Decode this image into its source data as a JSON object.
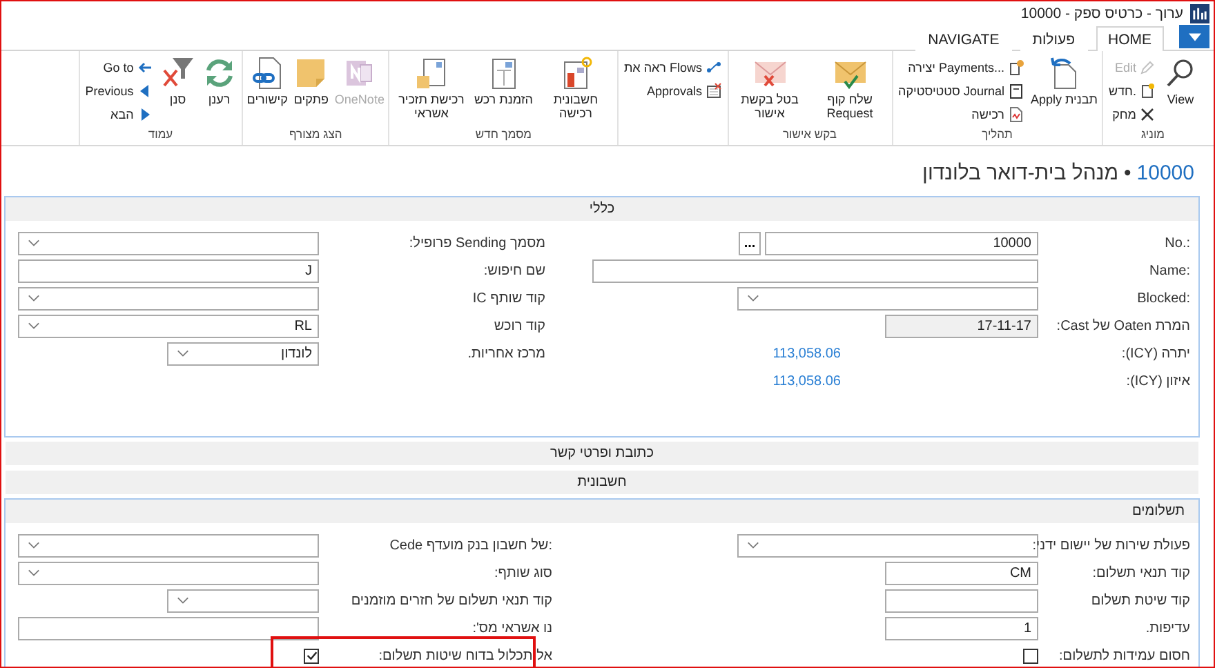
{
  "window": {
    "title": "ערוך - כרטיס ספק - 10000"
  },
  "tabs": [
    {
      "label": "HOME",
      "selected": true
    },
    {
      "label": "פעולות",
      "selected": false
    },
    {
      "label": "NAVIGATE",
      "selected": false
    }
  ],
  "ribbon": {
    "groups": [
      {
        "label": "מוניג",
        "items": [
          {
            "label": "View",
            "kind": "large",
            "disabled": false
          },
          {
            "label": "Edit",
            "kind": "small",
            "disabled": true
          },
          {
            "label": "חדש.",
            "kind": "small",
            "disabled": false
          },
          {
            "label": "מחק",
            "kind": "small",
            "disabled": false
          }
        ]
      },
      {
        "label": "תהליך",
        "items": [
          {
            "label": "Apply תבנית",
            "kind": "large",
            "disabled": false
          },
          {
            "label": "יצירה Payments...",
            "kind": "small",
            "disabled": false
          },
          {
            "label": "סטטיסטיקה Journal",
            "kind": "small",
            "disabled": false
          },
          {
            "label": "רכישה",
            "kind": "small",
            "disabled": false
          }
        ]
      },
      {
        "label": "בקש אישור",
        "items": [
          {
            "label": "שלח קוף Request",
            "kind": "large",
            "disabled": false
          },
          {
            "label": "בטל בקשת אישור",
            "kind": "large",
            "disabled": false
          }
        ]
      },
      {
        "items": [
          {
            "label": "ראה את Flows",
            "kind": "small",
            "disabled": false
          },
          {
            "label": "Approvals",
            "kind": "small",
            "disabled": false
          }
        ]
      },
      {
        "label": "מסמך חדש",
        "items": [
          {
            "label": "חשבונית רכישה",
            "kind": "large",
            "disabled": false
          },
          {
            "label": "הזמנת רכש",
            "kind": "large",
            "disabled": false
          },
          {
            "label": "רכישת תזכיר אשראי",
            "kind": "large",
            "disabled": false
          }
        ]
      },
      {
        "label": "הצג מצורף",
        "items": [
          {
            "label": "OneNote",
            "kind": "large",
            "disabled": true
          },
          {
            "label": "פתקים",
            "kind": "large",
            "disabled": false
          },
          {
            "label": "קישורים",
            "kind": "large",
            "disabled": false
          }
        ]
      },
      {
        "label": "עמוד",
        "items": [
          {
            "label": "רענן",
            "kind": "large",
            "disabled": false
          },
          {
            "label": "סנן",
            "kind": "large",
            "disabled": false
          },
          {
            "label": "Go to",
            "kind": "small",
            "disabled": false
          },
          {
            "label": "Previous",
            "kind": "small",
            "disabled": false
          },
          {
            "label": "הבא",
            "kind": "small",
            "disabled": false
          }
        ]
      }
    ]
  },
  "page_title": {
    "number": "10000",
    "separator": "•",
    "name": "מנהל בית-דואר בלונדון"
  },
  "sections": [
    {
      "title": "כללי",
      "expanded": true,
      "left": [
        {
          "label": "מסמך Sending פרופיל:",
          "kind": "dropdown"
        },
        {
          "label": "שם חיפוש:",
          "kind": "text",
          "value": "J"
        },
        {
          "label": "קוד שותף IC",
          "kind": "dropdown"
        },
        {
          "label": "קוד רוכש",
          "kind": "dropdown",
          "value": "RL"
        },
        {
          "label": "מרכז אחריות.",
          "kind": "small-dropdown",
          "value": "לונדון"
        }
      ],
      "right": [
        {
          "label": "No.:",
          "kind": "lookup",
          "value": "10000",
          "button": "..."
        },
        {
          "label": "Name:",
          "kind": "wide-text"
        },
        {
          "label": "Blocked:",
          "kind": "dropdown"
        },
        {
          "label": "המרת Oaten של Cast:",
          "kind": "readonly",
          "value": "17-11-17"
        },
        {
          "label": "יתרה (ICY):",
          "kind": "amount",
          "value": "113,058.06"
        },
        {
          "label": "איזון (ICY):",
          "kind": "amount",
          "value": "113,058.06"
        }
      ]
    },
    {
      "title": "כתובת ופרטי קשר",
      "expanded": false
    },
    {
      "title": "חשבונית",
      "expanded": false
    },
    {
      "title": "תשלומים",
      "expanded": true,
      "left": [
        {
          "label": "Cede של חשבון בנק מועדף:",
          "kind": "dropdown"
        },
        {
          "label": "סוג שותף:",
          "kind": "dropdown"
        },
        {
          "label": "קוד תנאי תשלום של חזרים מוזמנים",
          "kind": "small-dropdown"
        },
        {
          "label": "נו אשראי מס':",
          "kind": "text"
        },
        {
          "label": "אל תכלול בדוח שיטות תשלום:",
          "kind": "checkbox",
          "checked": true,
          "highlighted": true
        }
      ],
      "right": [
        {
          "label": "פעולת שירות של יישום ידני:",
          "kind": "dropdown"
        },
        {
          "label": "קוד תנאי תשלום:",
          "kind": "small-text",
          "value": "CM"
        },
        {
          "label": "קוד שיטת תשלום",
          "kind": "small-text"
        },
        {
          "label": "עדיפות.",
          "kind": "small-text",
          "value": "1"
        },
        {
          "label": "חסום עמידות לתשלום:",
          "kind": "checkbox",
          "checked": false,
          "highlighted": false
        }
      ]
    }
  ]
}
